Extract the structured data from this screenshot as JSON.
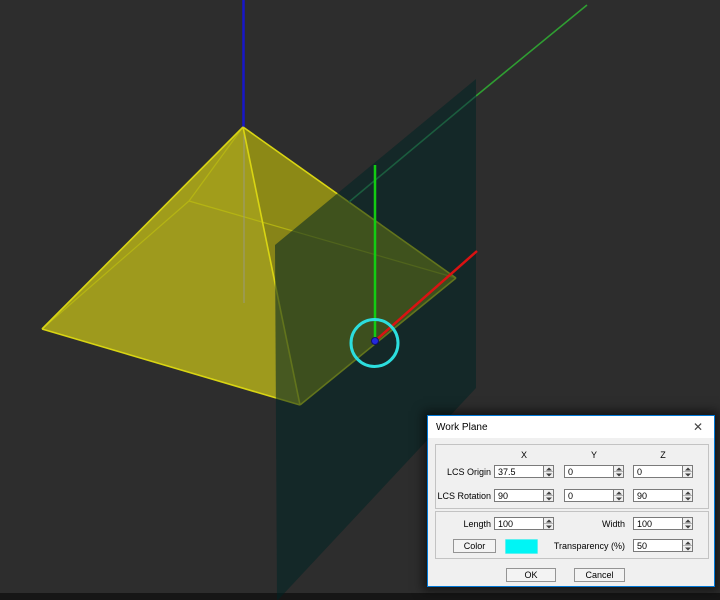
{
  "scene": {
    "colors": {
      "background": "#2d2d2d",
      "bottom_band": "#161616",
      "axis_x_red": "#da1212",
      "axis_y_green": "#2f9e32",
      "axis_y_green_dim": "#1b5c3e",
      "axis_z_blue": "#1717c9",
      "axis_z_through_pyramid": "#9a9a8c",
      "lcs_axis_green": "#12cc12",
      "pyramid_face_front_left": "#a4a01c",
      "pyramid_face_front_right": "#8f8c17",
      "pyramid_face_back_right": "#6b690f",
      "pyramid_face_back_left": "#50500d",
      "pyramid_edge_bright": "#d9d513",
      "pyramid_edge_inner": "#b9b912",
      "work_plane_fill": "#002424",
      "selection_circle": "#2cdede",
      "origin_dot": "#2429de",
      "origin_dot_border": "#11116e"
    }
  },
  "dialog": {
    "title": "Work Plane",
    "close_icon": "✕",
    "column_headers": [
      "X",
      "Y",
      "Z"
    ],
    "lcs_rows": [
      {
        "label": "LCS Origin",
        "values": [
          "37.5",
          "0",
          "0"
        ]
      },
      {
        "label": "LCS Rotation",
        "values": [
          "90",
          "0",
          "90"
        ]
      }
    ],
    "size_row": [
      {
        "label": "Length",
        "value": "100"
      },
      {
        "label": "Width",
        "value": "100"
      }
    ],
    "color_row": {
      "button_label": "Color",
      "swatch_color": "#00F5F5",
      "transparency_label": "Transparency (%)",
      "transparency_value": "50"
    },
    "buttons": {
      "ok": "OK",
      "cancel": "Cancel"
    }
  }
}
